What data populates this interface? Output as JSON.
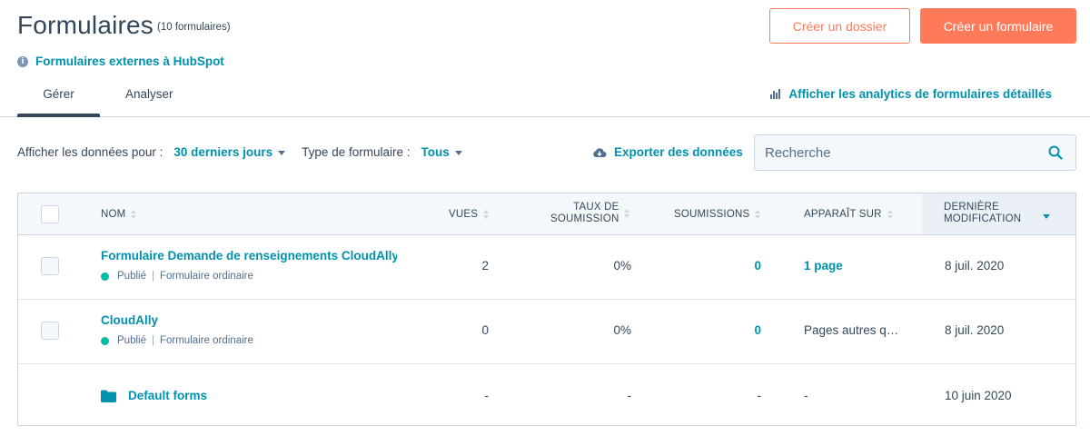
{
  "header": {
    "title": "Formulaires",
    "count": "(10 formulaires)",
    "create_folder": "Créer un dossier",
    "create_form": "Créer un formulaire",
    "external_link": "Formulaires externes à HubSpot"
  },
  "tabs": [
    {
      "label": "Gérer"
    },
    {
      "label": "Analyser"
    }
  ],
  "analytics_link": "Afficher les analytics de formulaires détaillés",
  "filters": {
    "period_label": "Afficher les données pour :",
    "period_value": "30 derniers jours",
    "type_label": "Type de formulaire :",
    "type_value": "Tous",
    "export": "Exporter des données"
  },
  "search": {
    "placeholder": "Recherche"
  },
  "table": {
    "columns": {
      "name": "NOM",
      "views": "VUES",
      "rate_1": "TAUX DE",
      "rate_2": "SOUMISSION",
      "submissions": "SOUMISSIONS",
      "appears": "APPARAÎT SUR",
      "modified_1": "DERNIÈRE",
      "modified_2": "MODIFICATION"
    },
    "rows": [
      {
        "name": "Formulaire Demande de renseignements CloudAlly",
        "status": "Publié",
        "type": "Formulaire ordinaire",
        "views": "2",
        "rate": "0%",
        "submissions": "0",
        "appears": "1 page",
        "modified": "8 juil. 2020"
      },
      {
        "name": "CloudAlly",
        "status": "Publié",
        "type": "Formulaire ordinaire",
        "views": "0",
        "rate": "0%",
        "submissions": "0",
        "appears": "Pages autres q…",
        "modified": "8 juil. 2020"
      },
      {
        "name": "Default forms",
        "views": "-",
        "rate": "-",
        "submissions": "-",
        "appears": "-",
        "modified": "10 juin 2020"
      }
    ]
  },
  "colors": {
    "accent": "#ff7a59",
    "link": "#0091ae",
    "text": "#33475b",
    "published": "#00bda5"
  }
}
